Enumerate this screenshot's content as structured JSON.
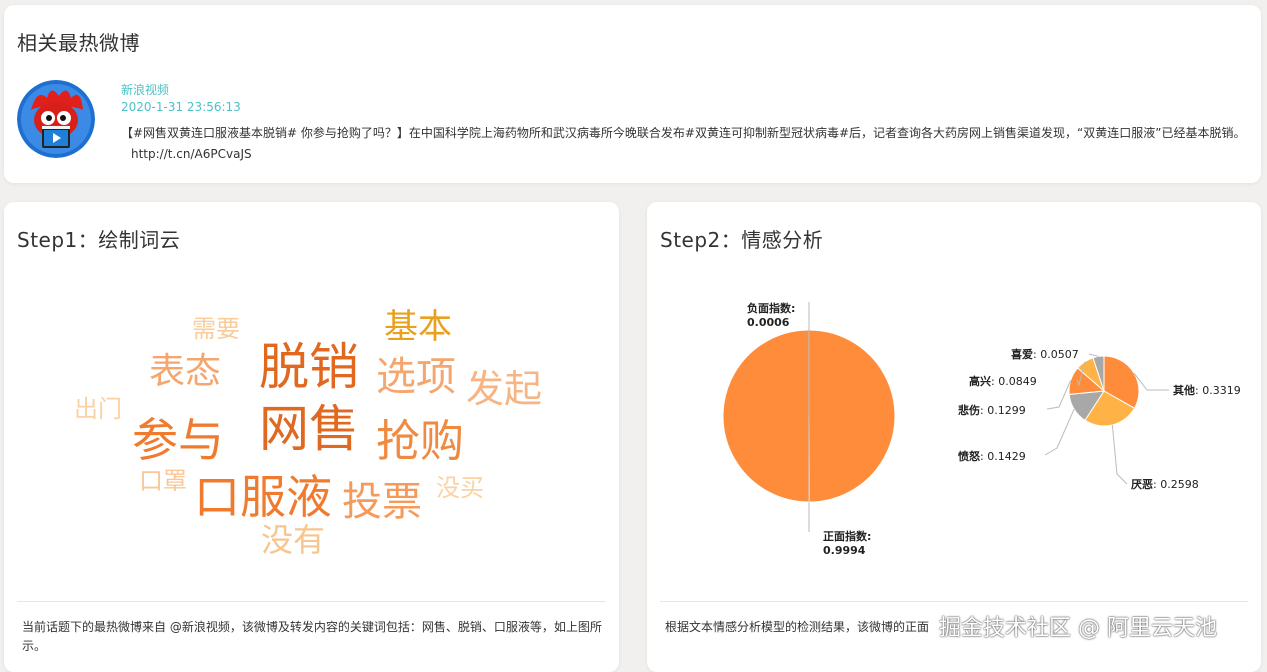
{
  "hot_post": {
    "title": "相关最热微博",
    "author": "新浪视频",
    "time": "2020-1-31 23:56:13",
    "text": "【#网售双黄连口服液基本脱销# 你参与抢购了吗？】在中国科学院上海药物所和武汉病毒所今晚联合发布#双黄连可抑制新型冠状病毒#后，记者查询各大药房网上销售渠道发现，“双黄连口服液”已经基本脱销。",
    "link": "http://t.cn/A6PCvaJS"
  },
  "wordcloud_card": {
    "title": "Step1：绘制词云",
    "caption": "当前话题下的最热微博来自 @新浪视频，该微博及转发内容的关键词包括：网售、脱销、口服液等，如上图所示。",
    "words": [
      {
        "text": "网售",
        "color": "#e0691f"
      },
      {
        "text": "脱销",
        "color": "#e0691f"
      },
      {
        "text": "口服液",
        "color": "#f07a2e"
      },
      {
        "text": "参与",
        "color": "#f07a2e"
      },
      {
        "text": "抢购",
        "color": "#f08a40"
      },
      {
        "text": "选项",
        "color": "#f5a66e"
      },
      {
        "text": "投票",
        "color": "#f59a5a"
      },
      {
        "text": "表态",
        "color": "#f5a66e"
      },
      {
        "text": "发起",
        "color": "#f7b583"
      },
      {
        "text": "基本",
        "color": "#e8a11e"
      },
      {
        "text": "没有",
        "color": "#f7c58e"
      },
      {
        "text": "需要",
        "color": "#f9cc9a"
      },
      {
        "text": "出门",
        "color": "#fad2a3"
      },
      {
        "text": "口罩",
        "color": "#f9c79a"
      },
      {
        "text": "没买",
        "color": "#fad2a3"
      }
    ]
  },
  "sentiment_card": {
    "title": "Step2：情感分析",
    "caption": "根据文本情感分析模型的检测结果，该微博的正面",
    "watermark": "掘金技术社区 @ 阿里云天池"
  },
  "chart_data": [
    {
      "type": "pie",
      "slices": [
        {
          "label": "正面指数",
          "value": 0.9994,
          "color": "#ff8c3b"
        },
        {
          "label": "负面指数",
          "value": 0.0006,
          "color": "#ffb347"
        }
      ]
    },
    {
      "type": "pie",
      "slices": [
        {
          "label": "其他",
          "value": 0.3319,
          "color": "#ff8c3b"
        },
        {
          "label": "厌恶",
          "value": 0.2598,
          "color": "#ffb347"
        },
        {
          "label": "愤怒",
          "value": 0.1429,
          "color": "#a8a8a8"
        },
        {
          "label": "悲伤",
          "value": 0.1299,
          "color": "#ff8c3b"
        },
        {
          "label": "高兴",
          "value": 0.0849,
          "color": "#ffb347"
        },
        {
          "label": "喜爱",
          "value": 0.0507,
          "color": "#a8a8a8"
        }
      ]
    }
  ]
}
